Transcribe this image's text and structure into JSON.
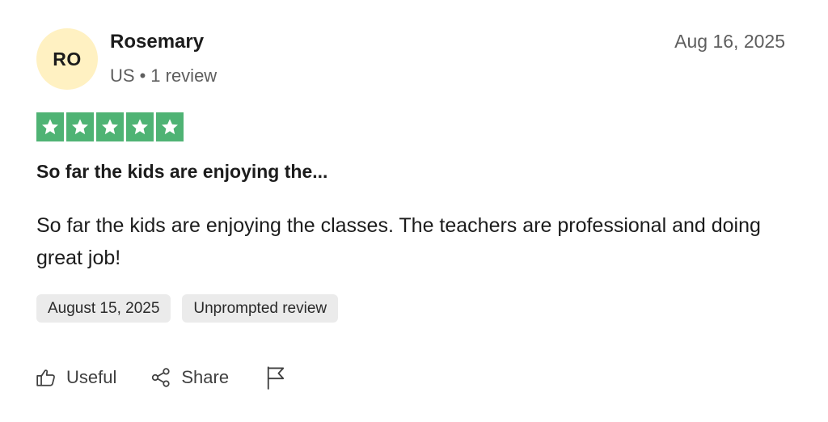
{
  "reviewer": {
    "initials": "RO",
    "name": "Rosemary",
    "country": "US",
    "separator": "•",
    "review_count": "1 review"
  },
  "review": {
    "posted_date": "Aug 16, 2025",
    "rating": 5,
    "rating_max": 5,
    "title": "So far the kids are enjoying the...",
    "body": "So far the kids are enjoying the classes. The teachers are professional and doing great job!",
    "tags": {
      "experience_date": "August 15, 2025",
      "review_type": "Unprompted review"
    }
  },
  "actions": {
    "useful_label": "Useful",
    "share_label": "Share"
  },
  "colors": {
    "star_green": "#4fb374",
    "avatar_bg": "#fff1c2",
    "tag_bg": "#ebebeb"
  },
  "icons": {
    "useful": "thumbs-up-icon",
    "share": "share-icon",
    "report": "flag-icon",
    "star": "star-icon"
  }
}
